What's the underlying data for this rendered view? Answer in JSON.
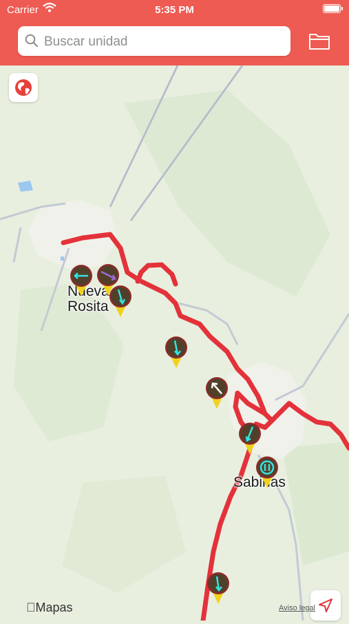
{
  "status_bar": {
    "carrier": "Carrier",
    "time": "5:35 PM"
  },
  "search": {
    "placeholder": "Buscar unidad"
  },
  "colors": {
    "header": "#ee5b52",
    "route": "#e3323a",
    "map": "#e8efdf"
  },
  "map": {
    "cities": [
      {
        "name": "Nueva\nRosita"
      },
      {
        "name": "Sabinas"
      }
    ],
    "markers": [
      {
        "id": "unit-1",
        "type": "moving"
      },
      {
        "id": "unit-2",
        "type": "moving"
      },
      {
        "id": "unit-3",
        "type": "moving"
      },
      {
        "id": "unit-4",
        "type": "moving"
      },
      {
        "id": "unit-5",
        "type": "heading"
      },
      {
        "id": "unit-6",
        "type": "moving"
      },
      {
        "id": "unit-7",
        "type": "paused"
      },
      {
        "id": "unit-8",
        "type": "moving"
      }
    ],
    "attribution": "Mapas",
    "legal_label": "Aviso legal"
  },
  "icons": [
    "wifi-icon",
    "battery-icon",
    "search-icon",
    "folder-icon",
    "globe-icon",
    "location-arrow-icon"
  ]
}
